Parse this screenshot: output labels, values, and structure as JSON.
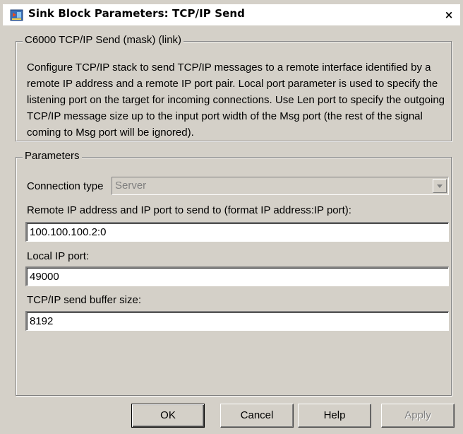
{
  "window": {
    "title": "Sink Block Parameters: TCP/IP Send",
    "close_glyph": "×"
  },
  "description_group": {
    "legend": "C6000 TCP/IP Send (mask) (link)",
    "text": "Configure TCP/IP stack  to send TCP/IP messages to a remote interface identified by a remote  IP address and a remote IP port pair. Local port parameter is used to specify the listening port on the target for incoming connections. Use Len port to specify the outgoing TCP/IP message size up to the input port width of the Msg port (the rest of the signal coming to Msg port will be ignored)."
  },
  "parameters_group": {
    "legend": "Parameters",
    "connection_type": {
      "label": "Connection type",
      "value": "Server",
      "enabled": false
    },
    "remote_ip": {
      "label": "Remote IP address and IP port to send to (format IP address:IP port):",
      "value": "100.100.100.2:0"
    },
    "local_port": {
      "label": "Local IP port:",
      "value": "49000"
    },
    "buffer_size": {
      "label": "TCP/IP send buffer size:",
      "value": "8192"
    }
  },
  "buttons": {
    "ok": "OK",
    "cancel": "Cancel",
    "help": "Help",
    "apply": "Apply"
  },
  "icons": {
    "app": "simulink-block-icon",
    "close": "close-icon",
    "dropdown": "chevron-down-icon"
  },
  "colors": {
    "dialog_bg": "#d4d0c8",
    "titlebar_bg": "#ffffff",
    "disabled_text": "#808080"
  }
}
